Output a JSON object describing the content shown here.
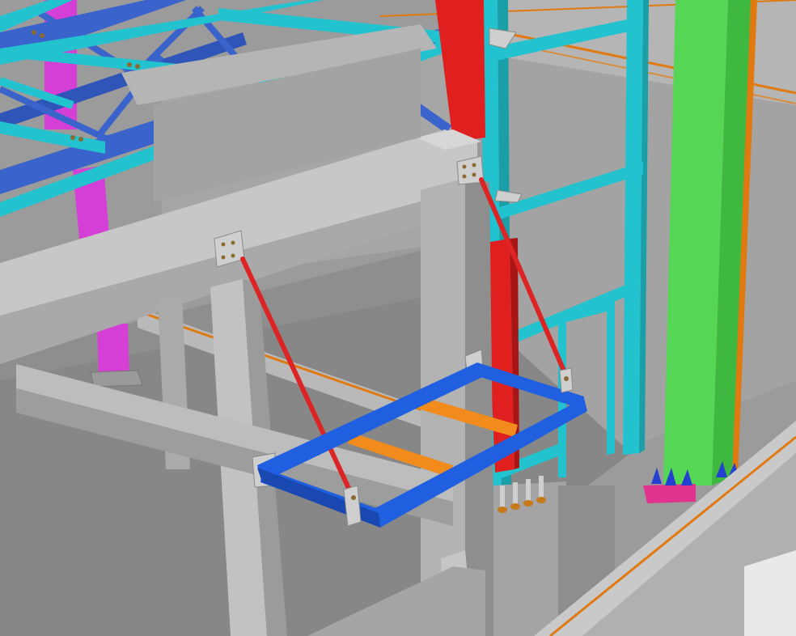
{
  "scene": {
    "colors": {
      "background_grey": "#9b9b9b",
      "concrete_light": "#c9c9c9",
      "concrete_mid": "#a9a9a9",
      "concrete_dark": "#8c8c8c",
      "truss_cyan": "#22c3cf",
      "truss_blue": "#3a64cc",
      "column_magenta": "#d63fd6",
      "column_red": "#e01f1f",
      "column_green": "#55d655",
      "hanger_rod_red": "#dc2424",
      "platform_frame_blue": "#1f5fe0",
      "platform_beam_orange": "#f08b1c",
      "edge_line_orange": "#e07a10",
      "base_plate_pink": "#e0348e",
      "anchor_blue": "#2540d0",
      "bolt_bronze": "#8a6a30"
    }
  }
}
